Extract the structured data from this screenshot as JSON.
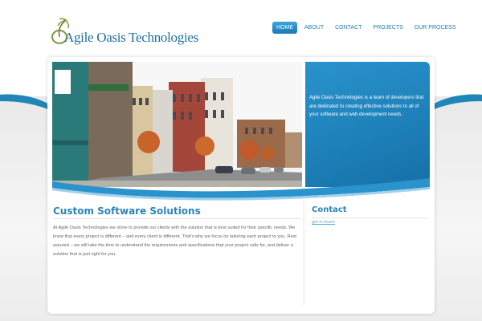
{
  "logo": {
    "text": "Agile Oasis Technologies"
  },
  "nav": {
    "items": [
      {
        "label": "HOME",
        "active": true
      },
      {
        "label": "ABOUT",
        "active": false
      },
      {
        "label": "CONTACT",
        "active": false
      },
      {
        "label": "PROJECTS",
        "active": false
      },
      {
        "label": "OUR PROCESS",
        "active": false
      }
    ]
  },
  "intro": {
    "text": "Agile Oasis Technologies is a team of developers that are dedicated to creating effective solutions to all of your software and web development needs."
  },
  "main": {
    "heading": "Custom Software Solutions",
    "body": "At Agile Oasis Technologies we strive to provide our clients with the solution that is best suited for their specific needs. We know that every project is different – and every client is different. That's why we focus on tailoring each project to you. Rest assured – we will take the time to understand the requirements and specifications that your project calls for, and deliver a solution that is just right for you."
  },
  "sidebar": {
    "heading": "Contact",
    "link": "get in touch"
  },
  "colors": {
    "brand_blue": "#1f86b8",
    "heading_blue": "#2c84b9",
    "link_blue": "#5aa9d6"
  }
}
